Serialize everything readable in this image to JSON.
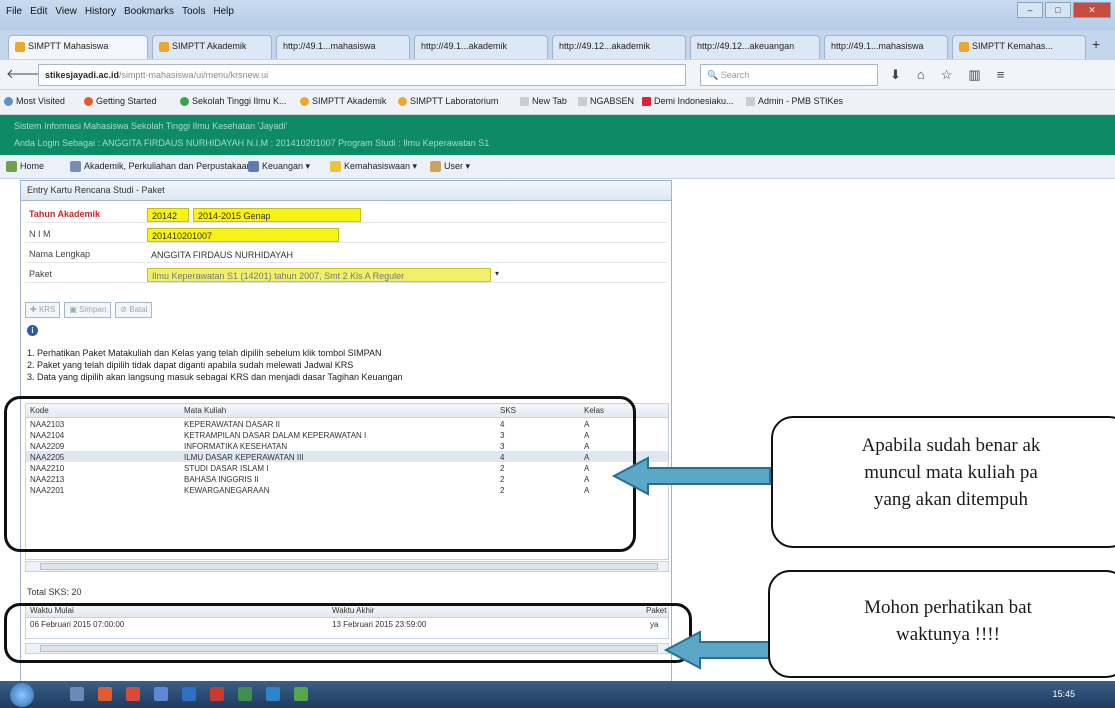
{
  "browser": {
    "menu": [
      "File",
      "Edit",
      "View",
      "History",
      "Bookmarks",
      "Tools",
      "Help"
    ],
    "tabs": [
      {
        "label": "SIMPTT Mahasiswa"
      },
      {
        "label": "SIMPTT Akademik"
      },
      {
        "label": "http://49.1...mahasiswa"
      },
      {
        "label": "http://49.1...akademik"
      },
      {
        "label": "http://49.12...akademik"
      },
      {
        "label": "http://49.12...akeuangan"
      },
      {
        "label": "http://49.1...mahasiswa"
      },
      {
        "label": "SIMPTT Kemahas..."
      }
    ],
    "url_domain": "stikesjayadi.ac.id",
    "url_rest": "/simptt-mahasiswa/ui/menu/krsnew.ui",
    "search_placeholder": "Search",
    "bookmarks": [
      "Most Visited",
      "Getting Started",
      "Sekolah Tinggi Ilmu K...",
      "SIMPTT Akademik",
      "SIMPTT Laboratorium",
      "New Tab",
      "NGABSEN",
      "Demi Indonesiaku...",
      "Admin - PMB STIKes"
    ]
  },
  "app": {
    "header_line1": "Sistem Informasi Mahasiswa Sekolah Tinggi Ilmu Kesehatan 'Jayadi'",
    "header_line2": "Anda Login Sebagai : ANGGITA FIRDAUS NURHIDAYAH    N.I.M : 201410201007    Program Studi : Ilmu Keperawatan S1",
    "menu": [
      "Home",
      "Akademik, Perkuliahan dan Perpustakaan",
      "Keuangan",
      "Kemahasiswaan",
      "User"
    ]
  },
  "panel": {
    "title": "Entry Kartu Rencana Studi - Paket",
    "fields": {
      "tahun_label": "Tahun Akademik",
      "tahun_code": "20142",
      "tahun_name": "2014-2015 Genap",
      "nim_label": "N I M",
      "nim_value": "201410201007",
      "nama_label": "Nama Lengkap",
      "nama_value": "ANGGITA FIRDAUS NURHIDAYAH",
      "paket_label": "Paket",
      "paket_value": "Ilmu Keperawatan S1 (14201) tahun 2007, Smt 2 Kls A Reguler"
    },
    "buttons": {
      "krs": "KRS",
      "simpan": "Simpan",
      "batal": "Batal"
    },
    "notes": [
      "1. Perhatikan Paket Matakuliah dan Kelas yang telah dipilih sebelum klik tombol SIMPAN",
      "2. Paket yang telah dipilih tidak dapat diganti apabila sudah melewati Jadwal KRS",
      "3. Data yang dipilih akan langsung masuk sebagai KRS dan menjadi dasar Tagihan Keuangan"
    ],
    "grid_headers": {
      "kode": "Kode",
      "mk": "Mata Kuliah",
      "sks": "SKS",
      "kelas": "Kelas"
    },
    "courses": [
      {
        "kode": "NAA2103",
        "mk": "KEPERAWATAN DASAR II",
        "sks": "4",
        "kelas": "A"
      },
      {
        "kode": "NAA2104",
        "mk": "KETRAMPILAN DASAR DALAM KEPERAWATAN I",
        "sks": "3",
        "kelas": "A"
      },
      {
        "kode": "NAA2209",
        "mk": "INFORMATIKA KESEHATAN",
        "sks": "3",
        "kelas": "A"
      },
      {
        "kode": "NAA2205",
        "mk": "ILMU DASAR KEPERAWATAN III",
        "sks": "4",
        "kelas": "A"
      },
      {
        "kode": "NAA2210",
        "mk": "STUDI DASAR ISLAM I",
        "sks": "2",
        "kelas": "A"
      },
      {
        "kode": "NAA2213",
        "mk": "BAHASA INGGRIS II",
        "sks": "2",
        "kelas": "A"
      },
      {
        "kode": "NAA2201",
        "mk": "KEWARGANEGARAAN",
        "sks": "2",
        "kelas": "A"
      }
    ],
    "total": "Total SKS: 20",
    "schedule_headers": {
      "mulai": "Waktu Mulai",
      "akhir": "Waktu Akhir",
      "paket": "Paket"
    },
    "schedule": {
      "mulai": "06 Februari 2015 07:00:00",
      "akhir": "13 Februari 2015 23:59:00",
      "paket": "ya"
    }
  },
  "callouts": {
    "c1_line1": "Apabila sudah benar ak",
    "c1_line2": "muncul mata kuliah pa",
    "c1_line3": "yang akan ditempuh",
    "c2_line1": "Mohon perhatikan bat",
    "c2_line2": "waktunya !!!!"
  },
  "taskbar": {
    "clock": "15:45"
  },
  "colors": {
    "header_green": "#0f8a66",
    "highlight_yellow": "#f8f217",
    "arrow_blue": "#5aa7c8"
  }
}
